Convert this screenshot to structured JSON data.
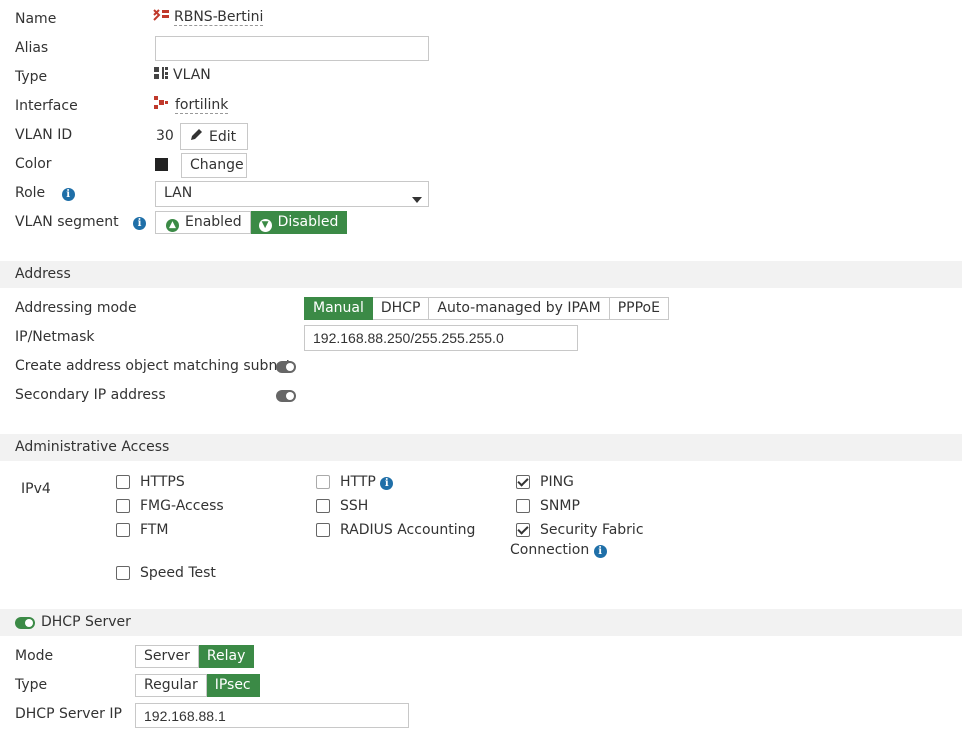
{
  "form": {
    "name_label": "Name",
    "name_value": "RBNS-Bertini",
    "alias_label": "Alias",
    "alias_value": "",
    "type_label": "Type",
    "type_value": "VLAN",
    "interface_label": "Interface",
    "interface_value": "fortilink",
    "vlan_id_label": "VLAN ID",
    "vlan_id_value": "30",
    "edit_label": "Edit",
    "color_label": "Color",
    "color_value": "#222222",
    "change_label": "Change",
    "role_label": "Role",
    "role_value": "LAN",
    "vlan_segment_label": "VLAN segment",
    "enabled_label": "Enabled",
    "disabled_label": "Disabled"
  },
  "address": {
    "section_title": "Address",
    "addressing_mode_label": "Addressing mode",
    "modes": [
      "Manual",
      "DHCP",
      "Auto-managed by IPAM",
      "PPPoE"
    ],
    "ip_label": "IP/Netmask",
    "ip_value": "192.168.88.250/255.255.255.0",
    "create_obj_label": "Create address object matching subnet",
    "secondary_label": "Secondary IP address"
  },
  "admin": {
    "section_title": "Administrative Access",
    "ipv4_label": "IPv4",
    "https": "HTTPS",
    "http": "HTTP",
    "ping": "PING",
    "fmg": "FMG-Access",
    "ssh": "SSH",
    "snmp": "SNMP",
    "ftm": "FTM",
    "radius": "RADIUS Accounting",
    "sec_fabric_1": "Security Fabric",
    "sec_fabric_2": "Connection",
    "speed_test": "Speed Test"
  },
  "dhcp": {
    "section_title": "DHCP Server",
    "mode_label": "Mode",
    "mode_server": "Server",
    "mode_relay": "Relay",
    "type_label": "Type",
    "type_regular": "Regular",
    "type_ipsec": "IPsec",
    "server_ip_label": "DHCP Server IP",
    "server_ip_value": "192.168.88.1"
  },
  "colors": {
    "accent": "#3b8a46",
    "info": "#1f6fa8",
    "section_bg": "#f2f2f2",
    "icon_red": "#c0392b"
  }
}
